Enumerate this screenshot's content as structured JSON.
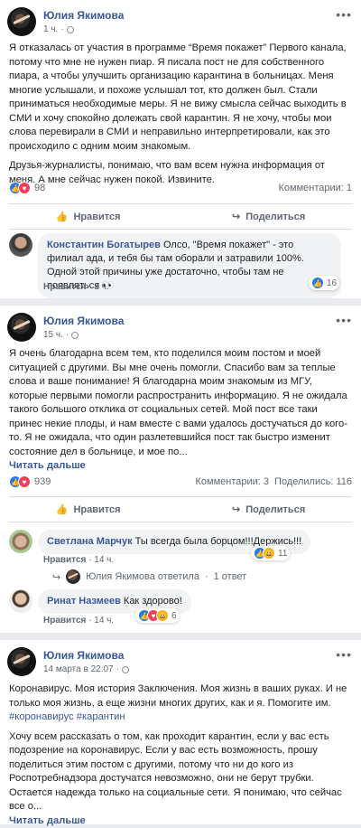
{
  "post1": {
    "author": "Юлия Якимова",
    "time": "1 ч.",
    "menu": "•••",
    "paragraphs": [
      "Я отказалась от участия в программе “Время покажет” Первого канала, потому что мне не нужен пиар. Я писала пост не для собственного пиара, а чтобы улучшить организацию карантина в больницах. Меня многие услышали, и похоже услышал тот, кто должен был. Стали приниматься необходимые меры. Я не вижу смысла сейчас выходить в СМИ и хочу спокойно доле­жать свой карантин. Я не хочу, чтобы мои слова перевирали в СМИ и неправильно интерпретировали, как это происходило с одним моим знакомым.",
      "Друзья-журналисты, понимаю, что вам всем нужна информация от меня. А мне сейчас нужен покой. Извините."
    ],
    "reactions_count": "98",
    "comments_label": "Комментарии: 1",
    "like_label": "Нравится",
    "share_label": "Поделиться"
  },
  "comment1": {
    "author": "Константин Богатырев",
    "text": "Олсо, \"Время покажет\" - это филиал ада, и тебя бы там оборали и затравили 100%. Одной этой причины уже достаточно, чтобы там не появляться 👀",
    "like": "Нравится",
    "sep": "·",
    "time": "1 ч.",
    "reactions": "16"
  },
  "post2": {
    "author": "Юлия Якимова",
    "time": "15 ч.",
    "menu": "•••",
    "text": "Я очень благодарна всем тем, кто поделился моим постом и моей ситуацией с другими. Вы мне очень помогли. Спасибо вам за теплые слова и ваше понимание! Я благодарна моим знакомым из МГУ, которые первыми помогли распространить информацию. Я не ожидала такого большого отклика от социальных сетей. Мой пост все таки принес некие плоды, и нам вместе с вами удалось достучаться до кого-то. Я не ожидала, что один разлетевшийся пост так быстро изменит состояние дел в больнице, и мое по...",
    "more": "Читать дальше",
    "reactions_count": "939",
    "comments_label": "Комментарии: 3",
    "shares_label": "Поделились: 116",
    "like_label": "Нравится",
    "share_label": "Поделиться"
  },
  "comment2": {
    "author": "Светлана Марчук",
    "text": "Ты всегда была борцом!!!Держись!!!",
    "like": "Нравится",
    "sep": "·",
    "time": "14 ч.",
    "reactions": "11"
  },
  "reply2": {
    "author": "Юлия Якимова",
    "replied": "ответила",
    "sep": "·",
    "count": "1 ответ"
  },
  "comment3": {
    "author": "Ринат Назмеев",
    "text": "Как здорово!",
    "like": "Нравится",
    "sep": "·",
    "time": "14 ч.",
    "reactions": "6"
  },
  "post3": {
    "author": "Юлия Якимова",
    "time": "14 марта в 22:07",
    "menu": "•••",
    "p1_text": "Коронавирус. Моя история Заключения. Моя жизнь в ваших руках. И не только моя жизнь, а еще жизни многих других, как и я. Помогите им.",
    "hashtags": "#коронавирус #карантин",
    "p2_text": "Хочу всем рассказать о том, как проходит карантин, если у вас есть подозрение на коронавирус. Если у вас есть возможность, прошу поделиться этим постом с другими, потому что ни до кого из Роспотребнадзора достучатся невозможно, они не берут трубки. Остается надежда только на социальные сети. Я понимаю, что сейчас все о...",
    "more": "Читать дальше"
  },
  "icons": {
    "like": "thumbs-up-icon",
    "share": "share-arrow-icon",
    "globe": "globe-icon",
    "reply": "reply-arrow-icon"
  },
  "colors": {
    "link": "#385898",
    "background": "#e9ebee",
    "like_blue": "#2078f4",
    "love_red": "#f33e58"
  }
}
